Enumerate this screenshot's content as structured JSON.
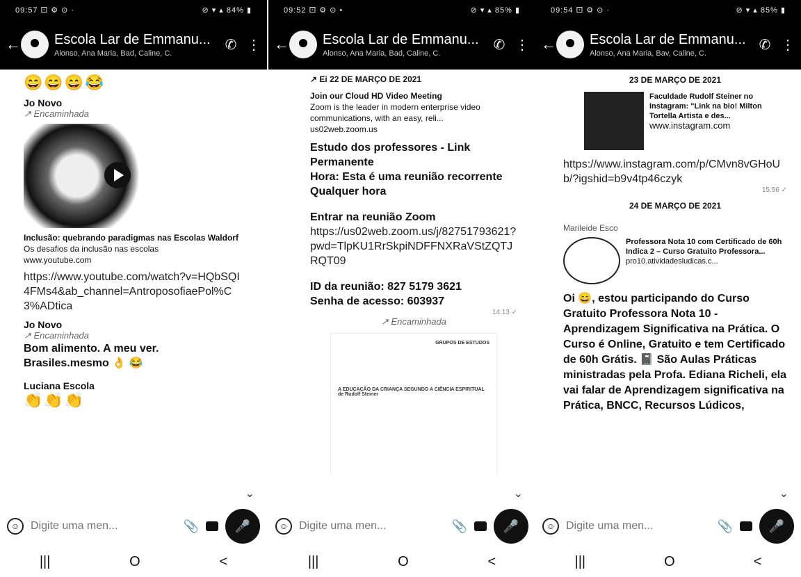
{
  "screens": [
    {
      "statusbar": {
        "left": "09:57 ⚀ ⚙ ⊙ ·",
        "right": "⊘ ▾ ▴ 84% ▮"
      },
      "header": {
        "title": "Escola Lar de Emmanu...",
        "subtitle": "Alonso, Ana Maria, Bad, Caline, C."
      },
      "messages": {
        "emojis": "😄😄😄😂",
        "sender1": "Jo Novo",
        "forward1": "Encaminhada",
        "video_title": "Inclusão: quebrando paradigmas nas Escolas Waldorf",
        "video_desc": "Os desafios da inclusão nas escolas",
        "video_domain": "www.youtube.com",
        "link": "https://www.youtube.com/watch?v=HQbSQI4FMs4&ab_channel=AntroposofiaePol%C3%ADtica",
        "sender2": "Jo Novo",
        "forward2": "Encaminhada",
        "text2": "Bom alimento. A meu ver. Brasiles.mesmo 👌 😂",
        "sender3": "Luciana Escola",
        "claps": "👏👏👏"
      },
      "input": {
        "placeholder": "Digite uma men..."
      }
    },
    {
      "statusbar": {
        "left": "09:52 ⚀ ⚙ ⊙ •",
        "right": "⊘ ▾ ▴ 85% ▮"
      },
      "header": {
        "title": "Escola Lar de Emmanu...",
        "subtitle": "Alonso, Ana Maria, Bad, Caline, C."
      },
      "messages": {
        "date": "22 DE MARÇO DE 2021",
        "zoom_title": "Join our Cloud HD Video Meeting",
        "zoom_desc": "Zoom is the leader in modern enterprise video communications, with an easy, reli...",
        "zoom_domain": "us02web.zoom.us",
        "title": "Estudo dos professores - Link Permanente",
        "hora": "Hora: Esta é uma reunião recorrente Qualquer hora",
        "entrar": "Entrar na reunião Zoom",
        "zoom_link": "https://us02web.zoom.us/j/82751793621?pwd=TlpKU1RrSkpiNDFFNXRaVStZQTJRQT09",
        "id": "ID da reunião: 827 5179 3621",
        "senha": "Senha de acesso: 603937",
        "time": "14:13 ✓",
        "forward": "Encaminhada",
        "doc_head": "GRUPOS DE ESTUDOS",
        "doc_body": "A EDUCAÇÃO DA CRIANÇA SEGUNDO A CIÊNCIA ESPIRITUAL de Rudolf Steiner"
      },
      "input": {
        "placeholder": "Digite uma men..."
      }
    },
    {
      "statusbar": {
        "left": "09:54 ⚀ ⚙ ⊙ ·",
        "right": "⊘ ▾ ▴ 85% ▮"
      },
      "header": {
        "title": "Escola Lar de Emmanu...",
        "subtitle": "Alonso, Ana Maria, Bav, Caline, C."
      },
      "messages": {
        "date1": "23 DE MARÇO DE 2021",
        "ig_title": "Faculdade Rudolf Steiner no Instagram: \"Link na bio! Milton Tortella Artista e des...",
        "ig_domain": "www.instagram.com",
        "ig_link": "https://www.instagram.com/p/CMvn8vGHoUb/?igshid=b9v4tp46czyk",
        "ig_time": "15:56 ✓",
        "date2": "24 DE MARÇO DE 2021",
        "sender": "Marileide Esco",
        "promo_title": "Professora Nota 10 com Certificado de 60h Indica 2 – Curso Gratuito Professora...",
        "promo_domain": "pro10.atividadesludicas.c...",
        "body": "Oi 😄, estou participando do Curso Gratuito Professora Nota 10 - Aprendizagem Significativa na Prática. O Curso é Online, Gratuito e tem Certificado de 60h Grátis. 📓 São Aulas Práticas ministradas pela Profa. Ediana Richeli, ela vai falar de Aprendizagem significativa na Prática, BNCC, Recursos Lúdicos,"
      },
      "input": {
        "placeholder": "Digite uma men..."
      }
    }
  ],
  "nav": {
    "recent": "|||",
    "home": "O",
    "back": "<"
  }
}
